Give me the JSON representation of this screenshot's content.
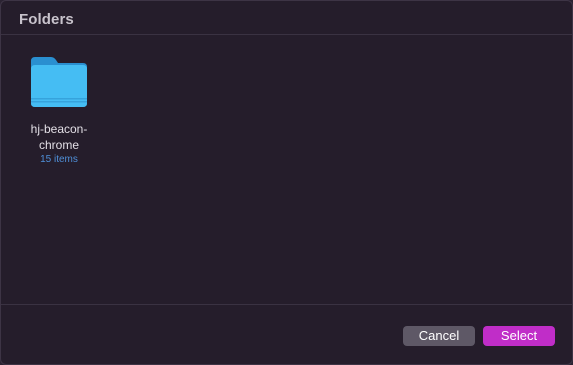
{
  "dialog": {
    "title": "Folders"
  },
  "folders": [
    {
      "name": "hj-beacon-chrome",
      "count": "15 items",
      "icon": "folder-icon"
    }
  ],
  "footer": {
    "cancel_label": "Cancel",
    "select_label": "Select"
  },
  "colors": {
    "background": "#251d2b",
    "folder": "#3fb6ef",
    "count_text": "#4f8fd8",
    "cancel_button": "#5e5866",
    "select_button": "#c02dc8"
  }
}
